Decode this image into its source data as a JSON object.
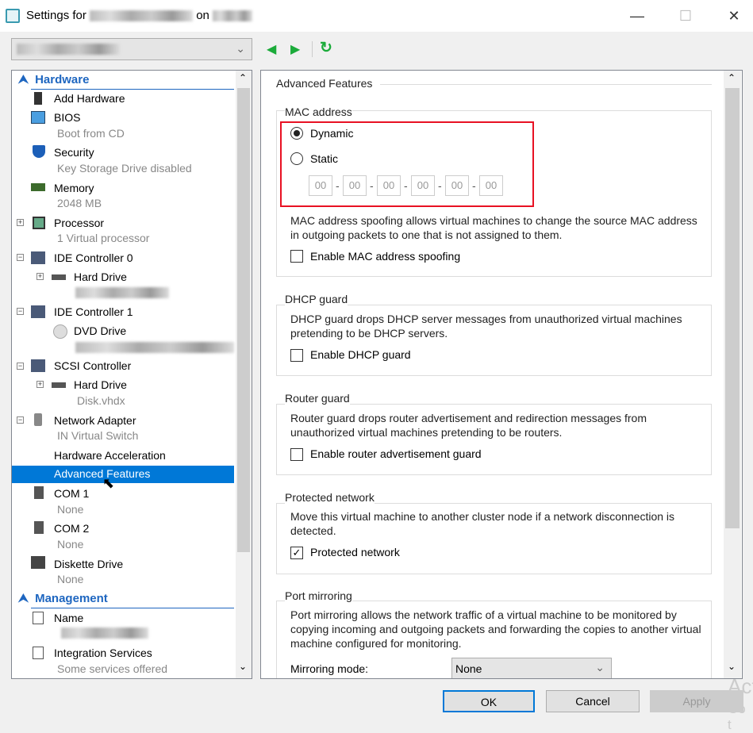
{
  "window": {
    "title_prefix": "Settings for",
    "title_mid": "on",
    "minimize": "—",
    "maximize": "☐",
    "close": "✕"
  },
  "nav": {
    "back": "◀",
    "forward": "▶",
    "refresh": "↻"
  },
  "tree": {
    "hardware_header": "Hardware",
    "management_header": "Management",
    "items": [
      {
        "label": "Add Hardware"
      },
      {
        "label": "BIOS",
        "sub": "Boot from CD"
      },
      {
        "label": "Security",
        "sub": "Key Storage Drive disabled"
      },
      {
        "label": "Memory",
        "sub": "2048 MB"
      },
      {
        "label": "Processor",
        "sub": "1 Virtual processor"
      },
      {
        "label": "IDE Controller 0"
      },
      {
        "label": "Hard Drive"
      },
      {
        "label": "IDE Controller 1"
      },
      {
        "label": "DVD Drive"
      },
      {
        "label": "SCSI Controller"
      },
      {
        "label": "Hard Drive",
        "sub": "Disk.vhdx"
      },
      {
        "label": "Network Adapter",
        "sub": "IN Virtual Switch"
      },
      {
        "label": "Hardware Acceleration"
      },
      {
        "label": "Advanced Features"
      },
      {
        "label": "COM 1",
        "sub": "None"
      },
      {
        "label": "COM 2",
        "sub": "None"
      },
      {
        "label": "Diskette Drive",
        "sub": "None"
      },
      {
        "label": "Name"
      },
      {
        "label": "Integration Services",
        "sub": "Some services offered"
      }
    ]
  },
  "panel": {
    "title": "Advanced Features",
    "mac": {
      "title": "MAC address",
      "dynamic": "Dynamic",
      "static": "Static",
      "selected": "Dynamic",
      "octets": [
        "00",
        "00",
        "00",
        "00",
        "00",
        "00"
      ],
      "spoof_desc": "MAC address spoofing allows virtual machines to change the source MAC address in outgoing packets to one that is not assigned to them.",
      "spoof_label": "Enable MAC address spoofing",
      "spoof_checked": false
    },
    "dhcp": {
      "title": "DHCP guard",
      "desc": "DHCP guard drops DHCP server messages from unauthorized virtual machines pretending to be DHCP servers.",
      "label": "Enable DHCP guard",
      "checked": false
    },
    "router": {
      "title": "Router guard",
      "desc": "Router guard drops router advertisement and redirection messages from unauthorized virtual machines pretending to be routers.",
      "label": "Enable router advertisement guard",
      "checked": false
    },
    "protected": {
      "title": "Protected network",
      "desc": "Move this virtual machine to another cluster node if a network disconnection is detected.",
      "label": "Protected network",
      "checked": true
    },
    "mirror": {
      "title": "Port mirroring",
      "desc": "Port mirroring allows the network traffic of a virtual machine to be monitored by copying incoming and outgoing packets and forwarding the copies to another virtual machine configured for monitoring.",
      "mode_label": "Mirroring mode:",
      "mode_value": "None"
    }
  },
  "buttons": {
    "ok": "OK",
    "cancel": "Cancel",
    "apply": "Apply"
  },
  "watermark": {
    "line1": "Act",
    "line2": "Go t"
  },
  "colors": {
    "accent": "#0078d7",
    "highlight": "#e81123",
    "section": "#1e66c0"
  }
}
